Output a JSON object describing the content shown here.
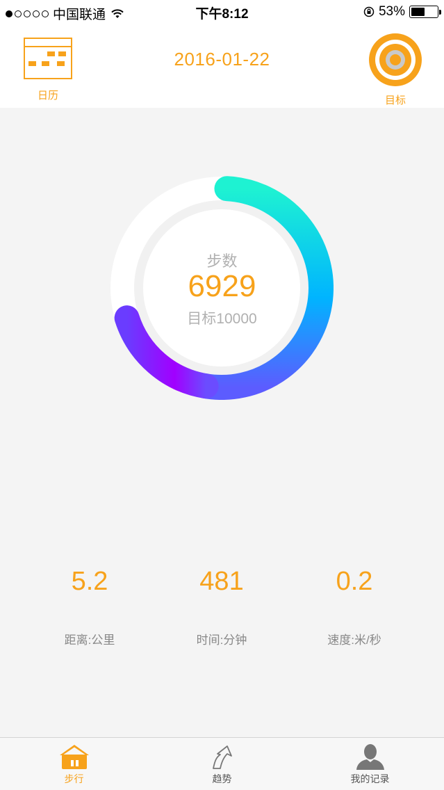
{
  "status_bar": {
    "carrier": "中国联通",
    "time": "下午8:12",
    "battery": "53%",
    "battery_level": 0.53,
    "signal_bars": 1
  },
  "header": {
    "date": "2016-01-22",
    "calendar_label": "日历",
    "target_label": "目标",
    "accent_color": "#f7a21b"
  },
  "progress": {
    "label": "步数",
    "steps": "6929",
    "goal_text": "目标10000",
    "fraction": 0.6929,
    "gradient_colors": [
      "#1ef2d2",
      "#00a8ff",
      "#7a44ff",
      "#a100ff"
    ]
  },
  "stats": [
    {
      "value": "5.2",
      "label": "距离:公里"
    },
    {
      "value": "481",
      "label": "时间:分钟"
    },
    {
      "value": "0.2",
      "label": "速度:米/秒"
    }
  ],
  "tabs": [
    {
      "label": "步行",
      "icon": "home-icon",
      "active": true
    },
    {
      "label": "趋势",
      "icon": "trend-arrow-icon",
      "active": false
    },
    {
      "label": "我的记录",
      "icon": "user-icon",
      "active": false
    }
  ]
}
